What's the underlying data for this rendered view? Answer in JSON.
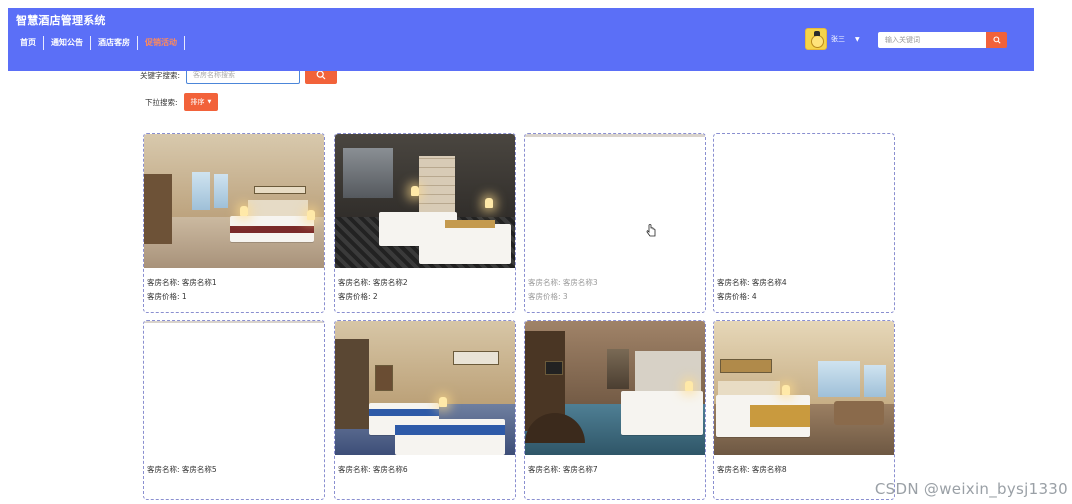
{
  "header": {
    "title": "智慧酒店管理系统",
    "nav": [
      {
        "label": "首页",
        "active": false
      },
      {
        "label": "通知公告",
        "active": false
      },
      {
        "label": "酒店客房",
        "active": false
      },
      {
        "label": "促销活动",
        "active": true
      }
    ],
    "user": {
      "name": "张三",
      "avatar_icon": "avatar-icon",
      "menu_icon": "caret-down-icon"
    },
    "search": {
      "placeholder": "输入关键词",
      "icon": "search-icon"
    }
  },
  "filters": {
    "keyword_label": "关键字搜索:",
    "keyword_placeholder": "客房名称搜索",
    "dropdown_label": "下拉搜索:",
    "sort_label": "排序"
  },
  "rooms": [
    {
      "name_label": "客房名称:",
      "name": "客房名称1",
      "price_label": "客房价格:",
      "price": "1",
      "has_photo": true
    },
    {
      "name_label": "客房名称:",
      "name": "客房名称2",
      "price_label": "客房价格:",
      "price": "2",
      "has_photo": true
    },
    {
      "name_label": "客房名称:",
      "name": "客房名称3",
      "price_label": "客房价格:",
      "price": "3",
      "has_photo": false
    },
    {
      "name_label": "客房名称:",
      "name": "客房名称4",
      "price_label": "客房价格:",
      "price": "4",
      "has_photo": false
    },
    {
      "name_label": "客房名称:",
      "name": "客房名称5",
      "has_photo": false
    },
    {
      "name_label": "客房名称:",
      "name": "客房名称6",
      "has_photo": true
    },
    {
      "name_label": "客房名称:",
      "name": "客房名称7",
      "has_photo": true
    },
    {
      "name_label": "客房名称:",
      "name": "客房名称8",
      "has_photo": true
    }
  ],
  "watermark": "CSDN @weixin_bysj1330",
  "colors": {
    "header_bg": "#5b6ff7",
    "accent": "#f2623a",
    "active_nav": "#ff8a5b"
  }
}
